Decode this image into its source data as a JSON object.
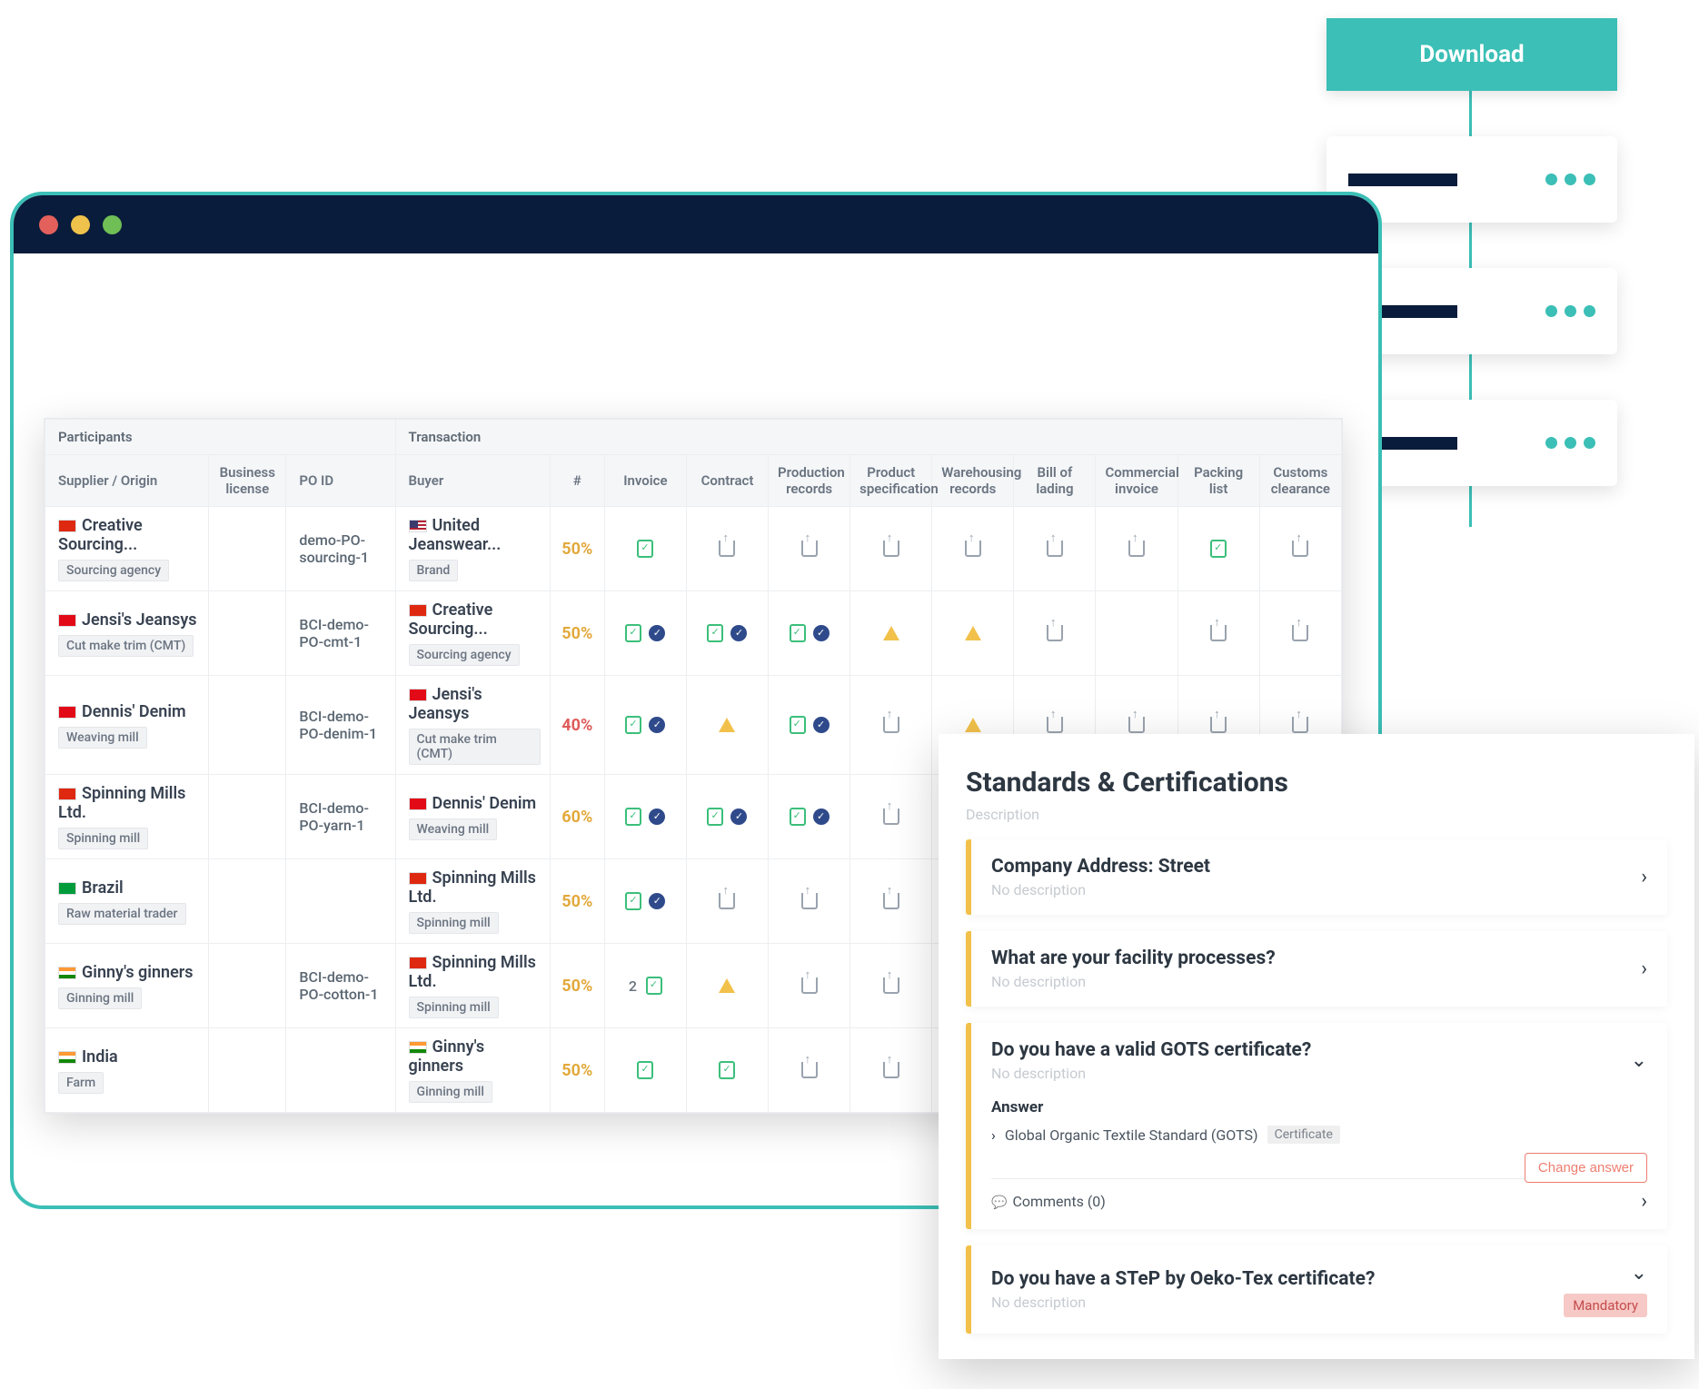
{
  "download_label": "Download",
  "float_cards": [
    {},
    {},
    {}
  ],
  "table": {
    "group_headers": {
      "participants": "Participants",
      "transaction": "Transaction"
    },
    "columns": {
      "supplier": "Supplier / Origin",
      "business_license": "Business license",
      "po_id": "PO ID",
      "buyer": "Buyer",
      "pct": "#",
      "invoice": "Invoice",
      "contract": "Contract",
      "production_records": "Production records",
      "product_spec": "Product specification",
      "warehousing": "Warehousing records",
      "bill_of_lading": "Bill of lading",
      "commercial_invoice": "Commercial invoice",
      "packing_list": "Packing list",
      "customs_clearance": "Customs clearance"
    },
    "rows": [
      {
        "supplier": {
          "flag": "cn",
          "name": "Creative Sourcing...",
          "type": "Sourcing agency"
        },
        "po": "demo-PO-sourcing-1",
        "buyer": {
          "flag": "us",
          "name": "United Jeanswear...",
          "type": "Brand"
        },
        "pct": "50%",
        "pct_class": "amber",
        "cells": [
          "doc",
          "upload",
          "upload",
          "upload",
          "upload",
          "upload",
          "upload",
          "doc",
          "upload"
        ]
      },
      {
        "supplier": {
          "flag": "tr",
          "name": "Jensi's Jeansys",
          "type": "Cut make trim (CMT)"
        },
        "po": "BCI-demo-PO-cmt-1",
        "buyer": {
          "flag": "cn",
          "name": "Creative Sourcing...",
          "type": "Sourcing agency"
        },
        "pct": "50%",
        "pct_class": "amber",
        "cells": [
          "doc-check",
          "doc-check",
          "doc-check",
          "warn",
          "warn",
          "upload",
          "",
          "upload",
          "upload"
        ]
      },
      {
        "supplier": {
          "flag": "tr",
          "name": "Dennis' Denim",
          "type": "Weaving mill"
        },
        "po": "BCI-demo-PO-denim-1",
        "buyer": {
          "flag": "tr",
          "name": "Jensi's Jeansys",
          "type": "Cut make trim (CMT)"
        },
        "pct": "40%",
        "pct_class": "red",
        "cells": [
          "doc-check",
          "warn",
          "doc-check",
          "upload",
          "warn",
          "upload",
          "upload",
          "upload",
          "upload"
        ]
      },
      {
        "supplier": {
          "flag": "cn",
          "name": "Spinning Mills Ltd.",
          "type": "Spinning mill"
        },
        "po": "BCI-demo-PO-yarn-1",
        "buyer": {
          "flag": "tr",
          "name": "Dennis' Denim",
          "type": "Weaving mill"
        },
        "pct": "60%",
        "pct_class": "amber",
        "cells": [
          "doc-check",
          "doc-check",
          "doc-check",
          "upload",
          "",
          "",
          "",
          "",
          ""
        ]
      },
      {
        "supplier": {
          "flag": "br",
          "name": "Brazil",
          "type": "Raw material trader"
        },
        "po": "",
        "buyer": {
          "flag": "cn",
          "name": "Spinning Mills Ltd.",
          "type": "Spinning mill"
        },
        "pct": "50%",
        "pct_class": "amber",
        "cells": [
          "doc-check",
          "upload",
          "upload",
          "upload",
          "",
          "",
          "",
          "",
          ""
        ]
      },
      {
        "supplier": {
          "flag": "in",
          "name": "Ginny's ginners",
          "type": "Ginning mill"
        },
        "po": "BCI-demo-PO-cotton-1",
        "buyer": {
          "flag": "cn",
          "name": "Spinning Mills Ltd.",
          "type": "Spinning mill"
        },
        "pct": "50%",
        "pct_class": "amber",
        "cells": [
          "2doc",
          "warn",
          "upload",
          "upload",
          "",
          "",
          "",
          "",
          ""
        ]
      },
      {
        "supplier": {
          "flag": "in",
          "name": "India",
          "type": "Farm"
        },
        "po": "",
        "buyer": {
          "flag": "in",
          "name": "Ginny's ginners",
          "type": "Ginning mill"
        },
        "pct": "50%",
        "pct_class": "amber",
        "cells": [
          "doc",
          "doc",
          "upload",
          "upload",
          "",
          "",
          "",
          "",
          ""
        ]
      }
    ]
  },
  "standards": {
    "title": "Standards & Certifications",
    "desc_label": "Description",
    "questions": [
      {
        "q": "Company Address: Street",
        "nd": "No description",
        "state": "collapsed"
      },
      {
        "q": "What are your facility processes?",
        "nd": "No description",
        "state": "collapsed"
      },
      {
        "q": "Do you have a valid GOTS certificate?",
        "nd": "No description",
        "state": "expanded",
        "answer_label": "Answer",
        "answer_text": "Global Organic Textile Standard (GOTS)",
        "cert_chip": "Certificate",
        "change_label": "Change answer",
        "comments_label": "Comments (0)"
      },
      {
        "q": "Do you have a STeP by Oeko-Tex certificate?",
        "nd": "No description",
        "state": "collapsed",
        "mandatory": "Mandatory"
      }
    ]
  }
}
